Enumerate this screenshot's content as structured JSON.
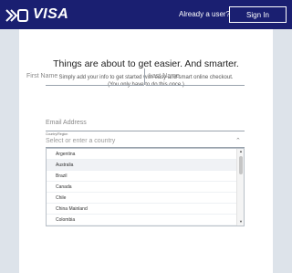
{
  "header": {
    "logo_text": "VISA",
    "already_user": "Already a user?",
    "signin_label": "Sign In",
    "brand_color": "#1a1f71"
  },
  "main": {
    "title": "Things are about to get easier. And smarter.",
    "subtitle_line1": "Simply add your info to get started with easy and smart online checkout.",
    "subtitle_line2": "(You only have to do this once.)",
    "first_name_placeholder": "First Name",
    "last_name_placeholder": "Last Name",
    "email_placeholder": "Email Address",
    "country_label": "Country/Region",
    "country_placeholder": "Select or enter a country"
  },
  "countries": [
    {
      "name": "Argentina"
    },
    {
      "name": "Australia",
      "highlighted": true
    },
    {
      "name": "Brazil"
    },
    {
      "name": "Canada"
    },
    {
      "name": "Chile"
    },
    {
      "name": "China Mainland"
    },
    {
      "name": "Colombia"
    }
  ],
  "icons": {
    "caret": "chevron-up-icon",
    "scroll_up": "scroll-up-arrow-icon",
    "scroll_down": "scroll-down-arrow-icon"
  }
}
